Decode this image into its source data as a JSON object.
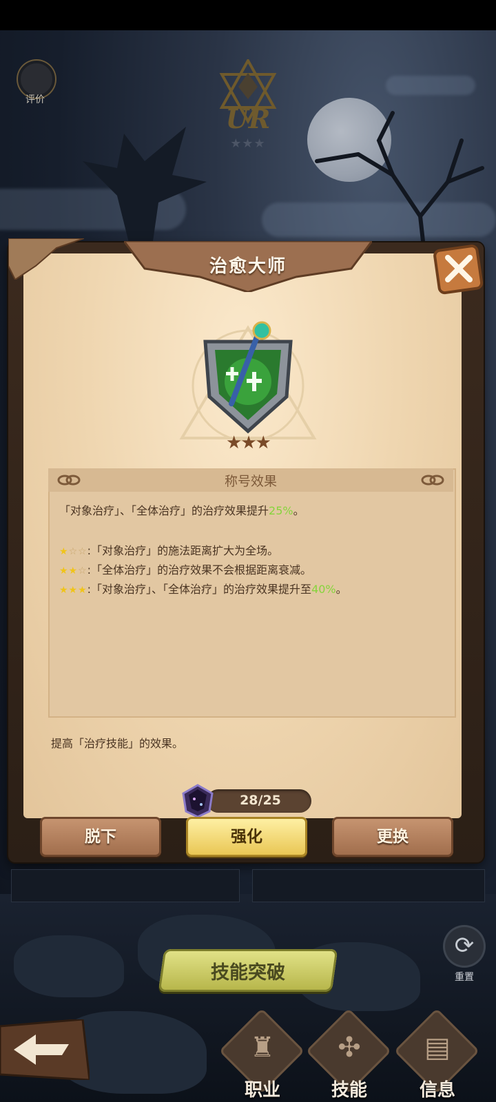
{
  "header": {
    "rating_label": "评价",
    "rarity": "UR",
    "rarity_stars": "★★★"
  },
  "dialog": {
    "title": "治愈大师",
    "close_icon": "close-icon",
    "emblem_stars": "★★★",
    "effect_section_title": "称号效果",
    "effect_main": {
      "pre": "「对象治疗」、「全体治疗」的治疗效果提升",
      "value": "25%",
      "post": "。"
    },
    "tiers": [
      {
        "stars_on": "★",
        "stars_off": "☆☆",
        "text": "「对象治疗」的施法距离扩大为全场。"
      },
      {
        "stars_on": "★★",
        "stars_off": "☆",
        "text": "「全体治疗」的治疗效果不会根据距离衰减。"
      },
      {
        "stars_on": "★★★",
        "stars_off": "",
        "text_pre": "「对象治疗」、「全体治疗」的治疗效果提升至",
        "value": "40%",
        "text_post": "。"
      }
    ],
    "description": "提高「治疗技能」的效果。",
    "progress": "28/25",
    "buttons": {
      "unequip": "脱下",
      "enhance": "强化",
      "replace": "更换"
    }
  },
  "bottom": {
    "breakthrough": "技能突破",
    "reset_label": "重置",
    "nav": [
      {
        "label": "职业",
        "icon": "class-icon"
      },
      {
        "label": "技能",
        "icon": "skill-icon"
      },
      {
        "label": "信息",
        "icon": "info-icon"
      }
    ]
  },
  "colors": {
    "highlight_green": "#86d43c",
    "star_gold": "#f0c419",
    "parchment": "#efd6b0"
  }
}
